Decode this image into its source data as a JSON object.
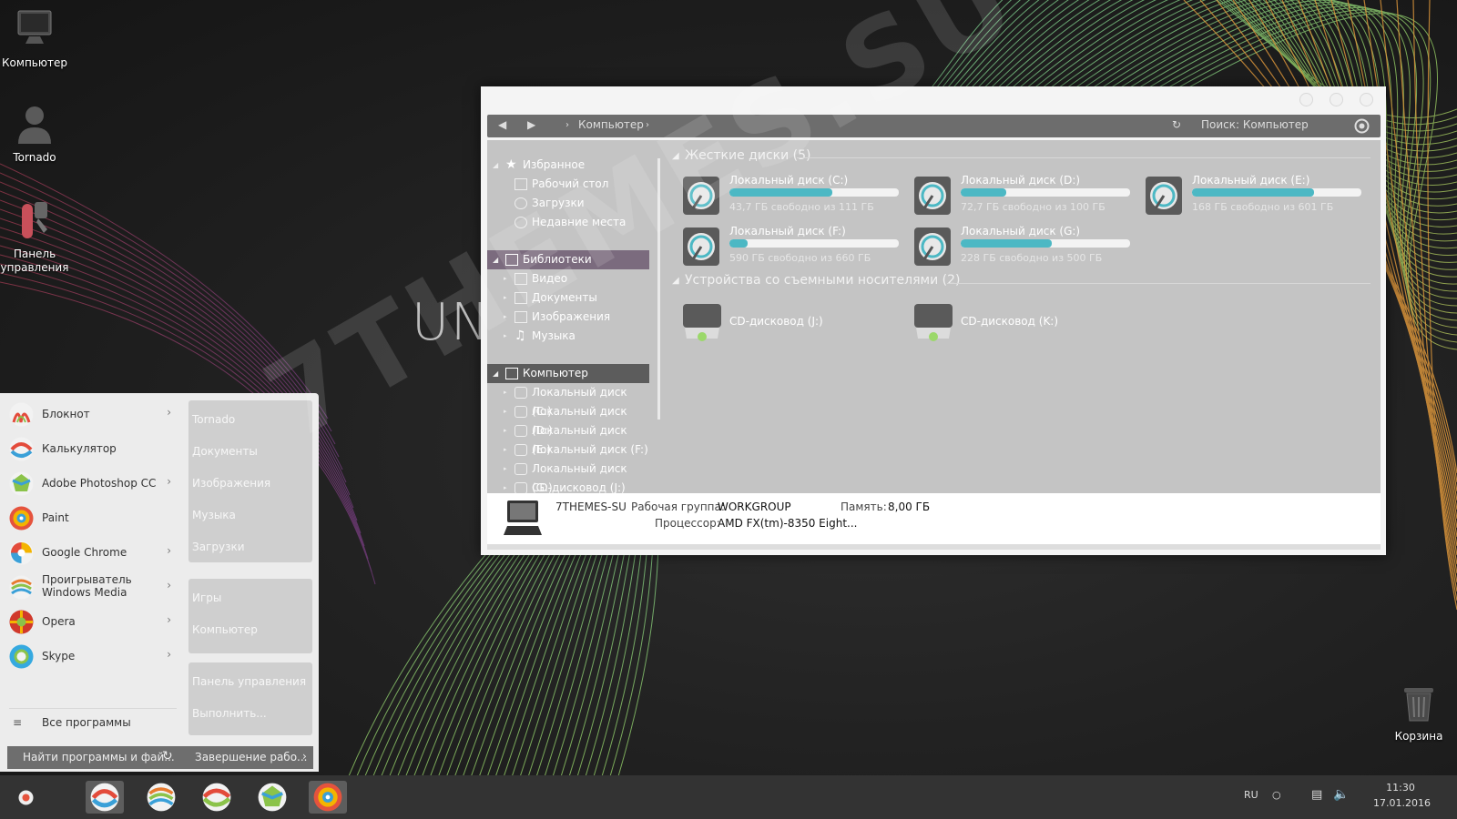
{
  "desktop": {
    "icons": [
      {
        "label": "Компьютер",
        "icon": "monitor-icon"
      },
      {
        "label": "Tornado",
        "icon": "user-icon"
      },
      {
        "label": "Панель управления",
        "icon": "control-panel-icon"
      },
      {
        "label": "Корзина",
        "icon": "trash-icon"
      }
    ],
    "watermark_un": "UN",
    "watermark_site": "7THEMES.SU"
  },
  "explorer": {
    "breadcrumb": "Компьютер",
    "search_placeholder": "Поиск: Компьютер",
    "nav": {
      "favorites": "Избранное",
      "favorites_items": [
        "Рабочий стол",
        "Загрузки",
        "Недавние места"
      ],
      "libraries": "Библиотеки",
      "libraries_items": [
        "Видео",
        "Документы",
        "Изображения",
        "Музыка"
      ],
      "computer": "Компьютер",
      "computer_items": [
        "Локальный диск (C:)",
        "Локальный диск (D:)",
        "Локальный диск (E:)",
        "Локальный диск (F:)",
        "Локальный диск (G:)",
        "CD-дисковод (J:)"
      ]
    },
    "hard_drives_title": "Жесткие диски (5)",
    "drives": [
      {
        "name": "Локальный диск (C:)",
        "free": "43,7 ГБ свободно из 111 ГБ",
        "used_fraction": 0.61
      },
      {
        "name": "Локальный диск (D:)",
        "free": "72,7 ГБ свободно из 100 ГБ",
        "used_fraction": 0.27
      },
      {
        "name": "Локальный диск (E:)",
        "free": "168 ГБ свободно из 601 ГБ",
        "used_fraction": 0.72
      },
      {
        "name": "Локальный диск (F:)",
        "free": "590 ГБ свободно из 660 ГБ",
        "used_fraction": 0.11
      },
      {
        "name": "Локальный диск (G:)",
        "free": "228 ГБ свободно из 500 ГБ",
        "used_fraction": 0.54
      }
    ],
    "removable_title": "Устройства со съемными носителями (2)",
    "removable": [
      {
        "name": "CD-дисковод (J:)"
      },
      {
        "name": "CD-дисковод (K:)"
      }
    ],
    "details": {
      "computer_name": "7THEMES-SU",
      "workgroup_label": "Рабочая группа:",
      "workgroup_value": "WORKGROUP",
      "memory_label": "Память:",
      "memory_value": "8,00 ГБ",
      "cpu_label": "Процессор:",
      "cpu_value": "AMD FX(tm)-8350 Eight..."
    }
  },
  "start_menu": {
    "programs": [
      {
        "name": "Блокнот",
        "submenu": true,
        "color": "#e34b3b"
      },
      {
        "name": "Калькулятор",
        "submenu": false,
        "color": "#3aa0d8"
      },
      {
        "name": "Adobe Photoshop CC",
        "submenu": true,
        "color": "#8bc34a"
      },
      {
        "name": "Paint",
        "submenu": false,
        "color": "#e5533d"
      },
      {
        "name": "Google Chrome",
        "submenu": true,
        "color": "#f4b400"
      },
      {
        "name": "Проигрыватель Windows Media",
        "submenu": true,
        "color": "#e77b2f"
      },
      {
        "name": "Opera",
        "submenu": true,
        "color": "#d0392b"
      },
      {
        "name": "Skype",
        "submenu": true,
        "color": "#35a9e0"
      }
    ],
    "all_programs": "Все программы",
    "right_links_1": [
      "Tornado",
      "Документы",
      "Изображения",
      "Музыка",
      "Загрузки"
    ],
    "right_links_2": [
      "Игры",
      "Компьютер"
    ],
    "right_links_3": [
      "Панель управления",
      "Выполнить..."
    ],
    "search_placeholder": "Найти программы и фай...",
    "shutdown": "Завершение рабо..."
  },
  "taskbar": {
    "language": "RU",
    "time": "11:30",
    "date": "17.01.2016"
  }
}
